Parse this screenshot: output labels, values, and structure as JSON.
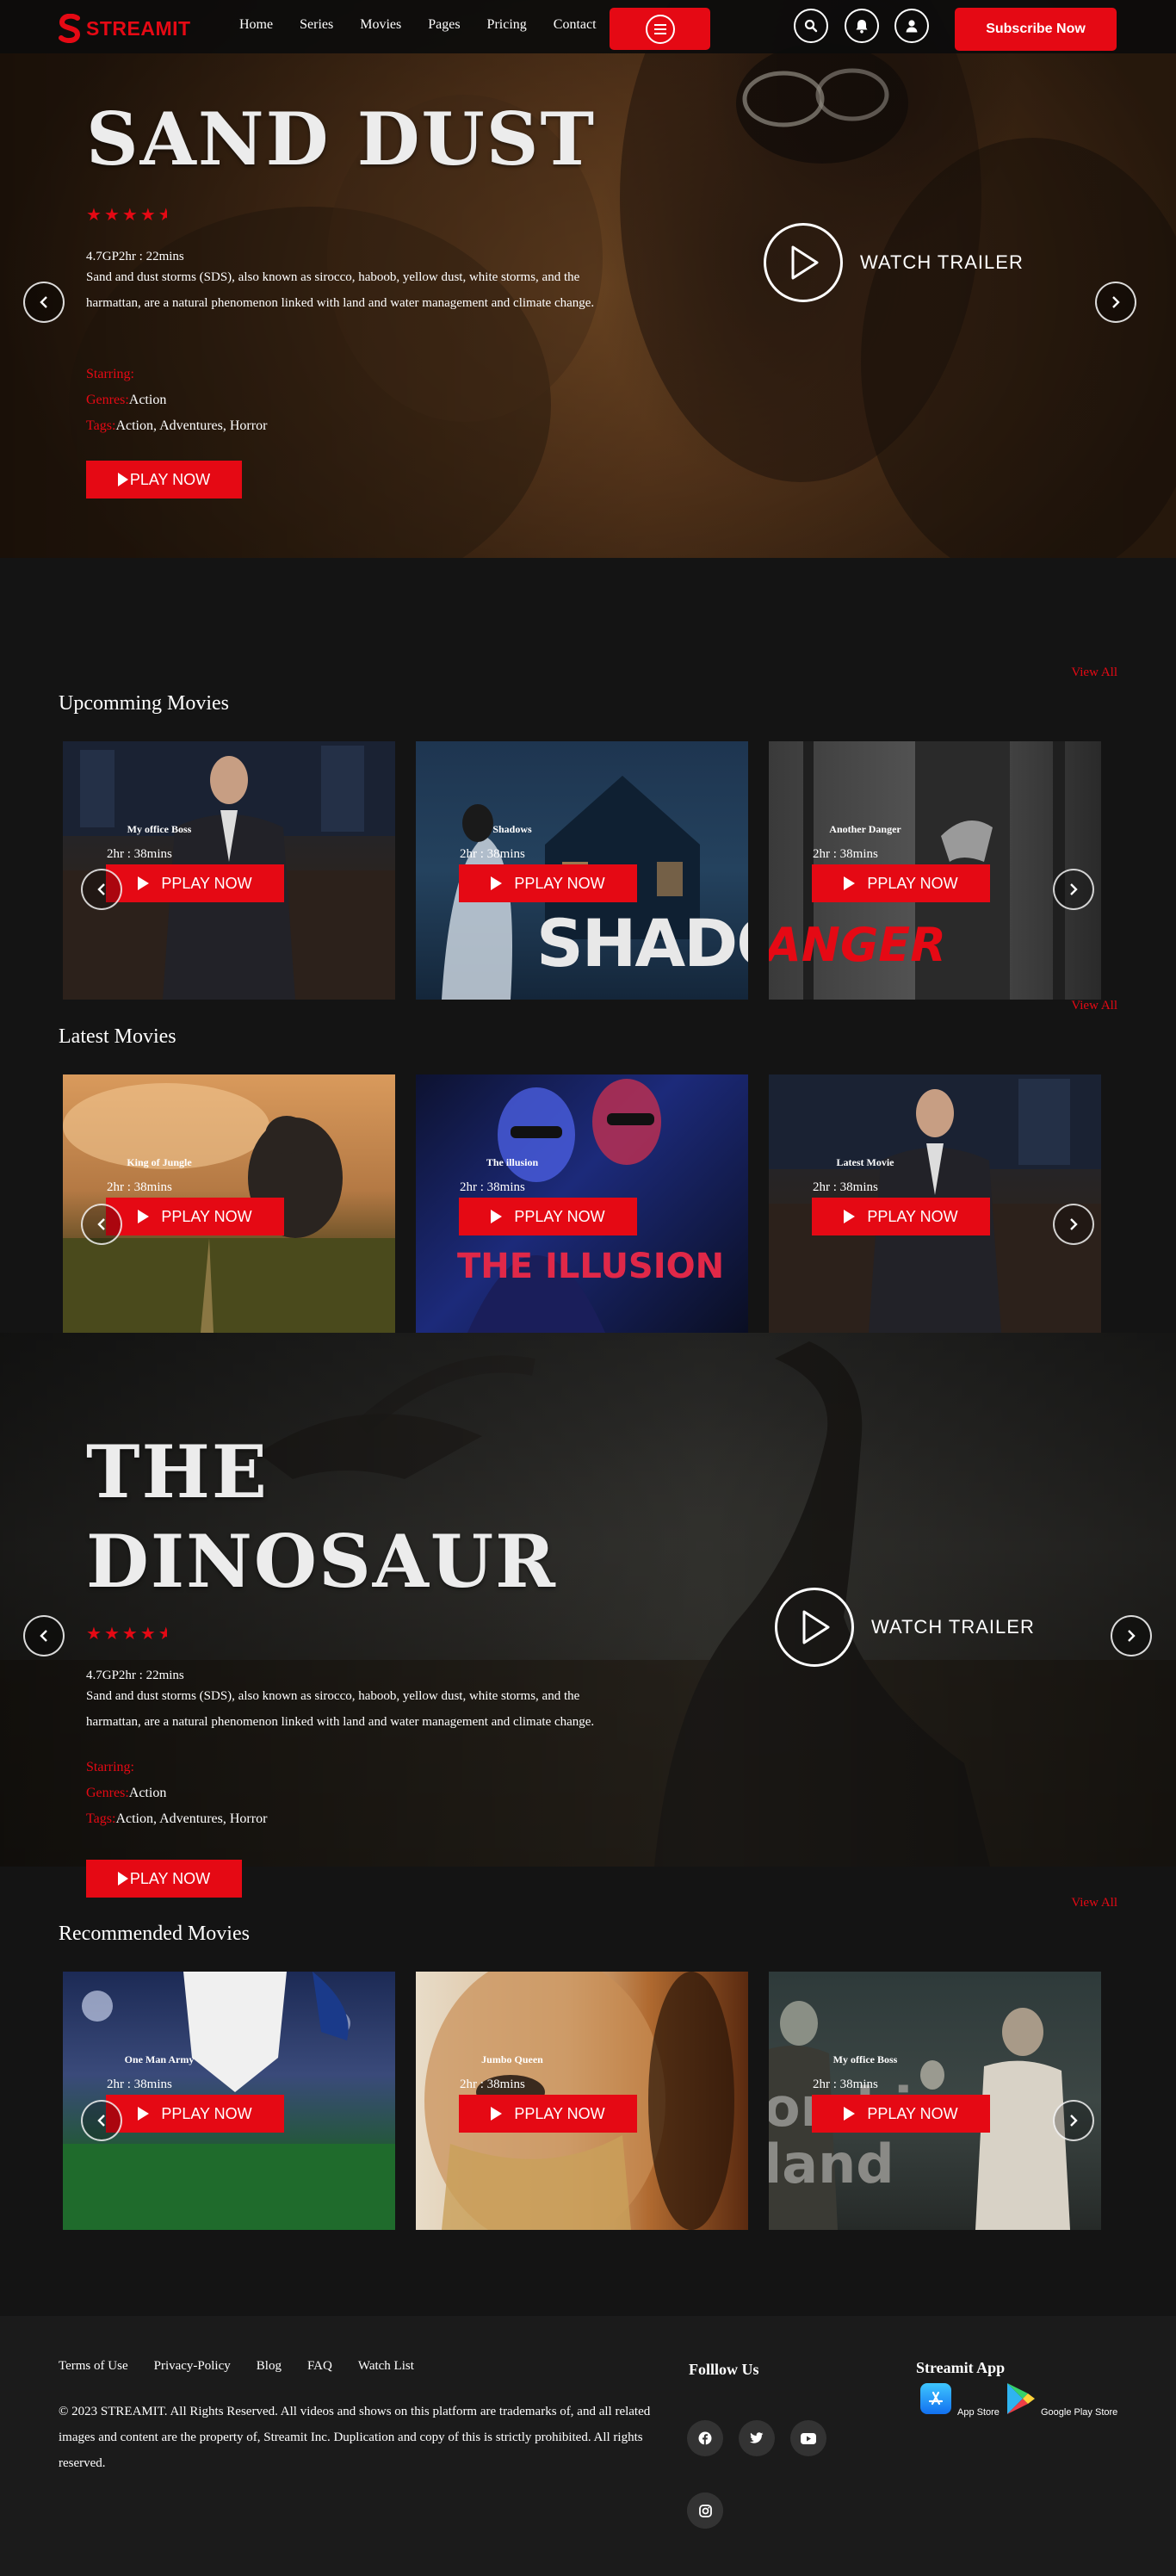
{
  "brand": {
    "name": "STREAMIT"
  },
  "nav": {
    "items": [
      "Home",
      "Series",
      "Movies",
      "Pages",
      "Pricing",
      "Contact"
    ],
    "subscribe_label": "Subscribe Now"
  },
  "hero1": {
    "title": "SAND DUST",
    "rating": 4.5,
    "meta": "4.7GP2hr : 22mins",
    "description": "Sand and dust storms (SDS), also known as sirocco, haboob, yellow dust, white storms, and the harmattan, are a natural phenomenon linked with land and water management and climate change.",
    "starring_label": "Starring:",
    "starring_value": "",
    "genres_label": "Genres:",
    "genres_value": "Action",
    "tags_label": "Tags:",
    "tags_value": "Action, Adventures, Horror",
    "play_label": "PLAY NOW",
    "trailer_label": "WATCH TRAILER"
  },
  "upcoming": {
    "title": "Upcomming Movies",
    "view_all": "View All",
    "cards": [
      {
        "title": "My office Boss",
        "duration": "2hr : 38mins",
        "play_label": "PPLAY NOW"
      },
      {
        "title": "Shadows",
        "duration": "2hr : 38mins",
        "play_label": "PPLAY NOW",
        "poster_text": "SHADOV"
      },
      {
        "title": "Another Danger",
        "duration": "2hr : 38mins",
        "play_label": "PPLAY NOW",
        "poster_text": "ANGER"
      }
    ]
  },
  "latest": {
    "title": "Latest Movies",
    "view_all": "View All",
    "cards": [
      {
        "title": "King of Jungle",
        "duration": "2hr : 38mins",
        "play_label": "PPLAY NOW"
      },
      {
        "title": "The illusion",
        "duration": "2hr : 38mins",
        "play_label": "PPLAY NOW",
        "poster_text": "THE ILLUSION"
      },
      {
        "title": "Latest Movie",
        "duration": "2hr : 38mins",
        "play_label": "PPLAY NOW"
      }
    ]
  },
  "hero2": {
    "title_line1": "THE",
    "title_line2": "DINOSAUR",
    "rating": 4.5,
    "meta": "4.7GP2hr : 22mins",
    "description": "Sand and dust storms (SDS), also known as sirocco, haboob, yellow dust, white storms, and the harmattan, are a natural phenomenon linked with land and water management and climate change.",
    "starring_label": "Starring:",
    "starring_value": "",
    "genres_label": "Genres:",
    "genres_value": "Action",
    "tags_label": "Tags:",
    "tags_value": "Action, Adventures, Horror",
    "play_label": "PLAY NOW",
    "trailer_label": "WATCH TRAILER"
  },
  "recommended": {
    "title": "Recommended Movies",
    "view_all": "View All",
    "cards": [
      {
        "title": "One Man Army",
        "duration": "2hr : 38mins",
        "play_label": "PPLAY NOW"
      },
      {
        "title": "Jumbo Queen",
        "duration": "2hr : 38mins",
        "play_label": "PPLAY NOW"
      },
      {
        "title": "My office Boss",
        "duration": "2hr : 38mins",
        "play_label": "PPLAY NOW",
        "poster_text_1": "ombie",
        "poster_text_2": "land"
      }
    ]
  },
  "footer": {
    "links": [
      "Terms of Use",
      "Privacy-Policy",
      "Blog",
      "FAQ",
      "Watch List"
    ],
    "copyright": "© 2023 STREAMIT. All Rights Reserved. All videos and shows on this platform are trademarks of, and all related images and content are the property of, Streamit Inc. Duplication and copy of this is strictly prohibited. All rights reserved.",
    "follow_title": "Folllow Us",
    "social_icons": [
      "facebook-icon",
      "twitter-icon",
      "youtube-icon",
      "instagram-icon"
    ],
    "app_title": "Streamit App",
    "app_store_label": "App Store",
    "play_store_label": "Google Play Store"
  },
  "colors": {
    "accent": "#e50914",
    "background": "#141414",
    "footer": "#1b1b1b"
  }
}
